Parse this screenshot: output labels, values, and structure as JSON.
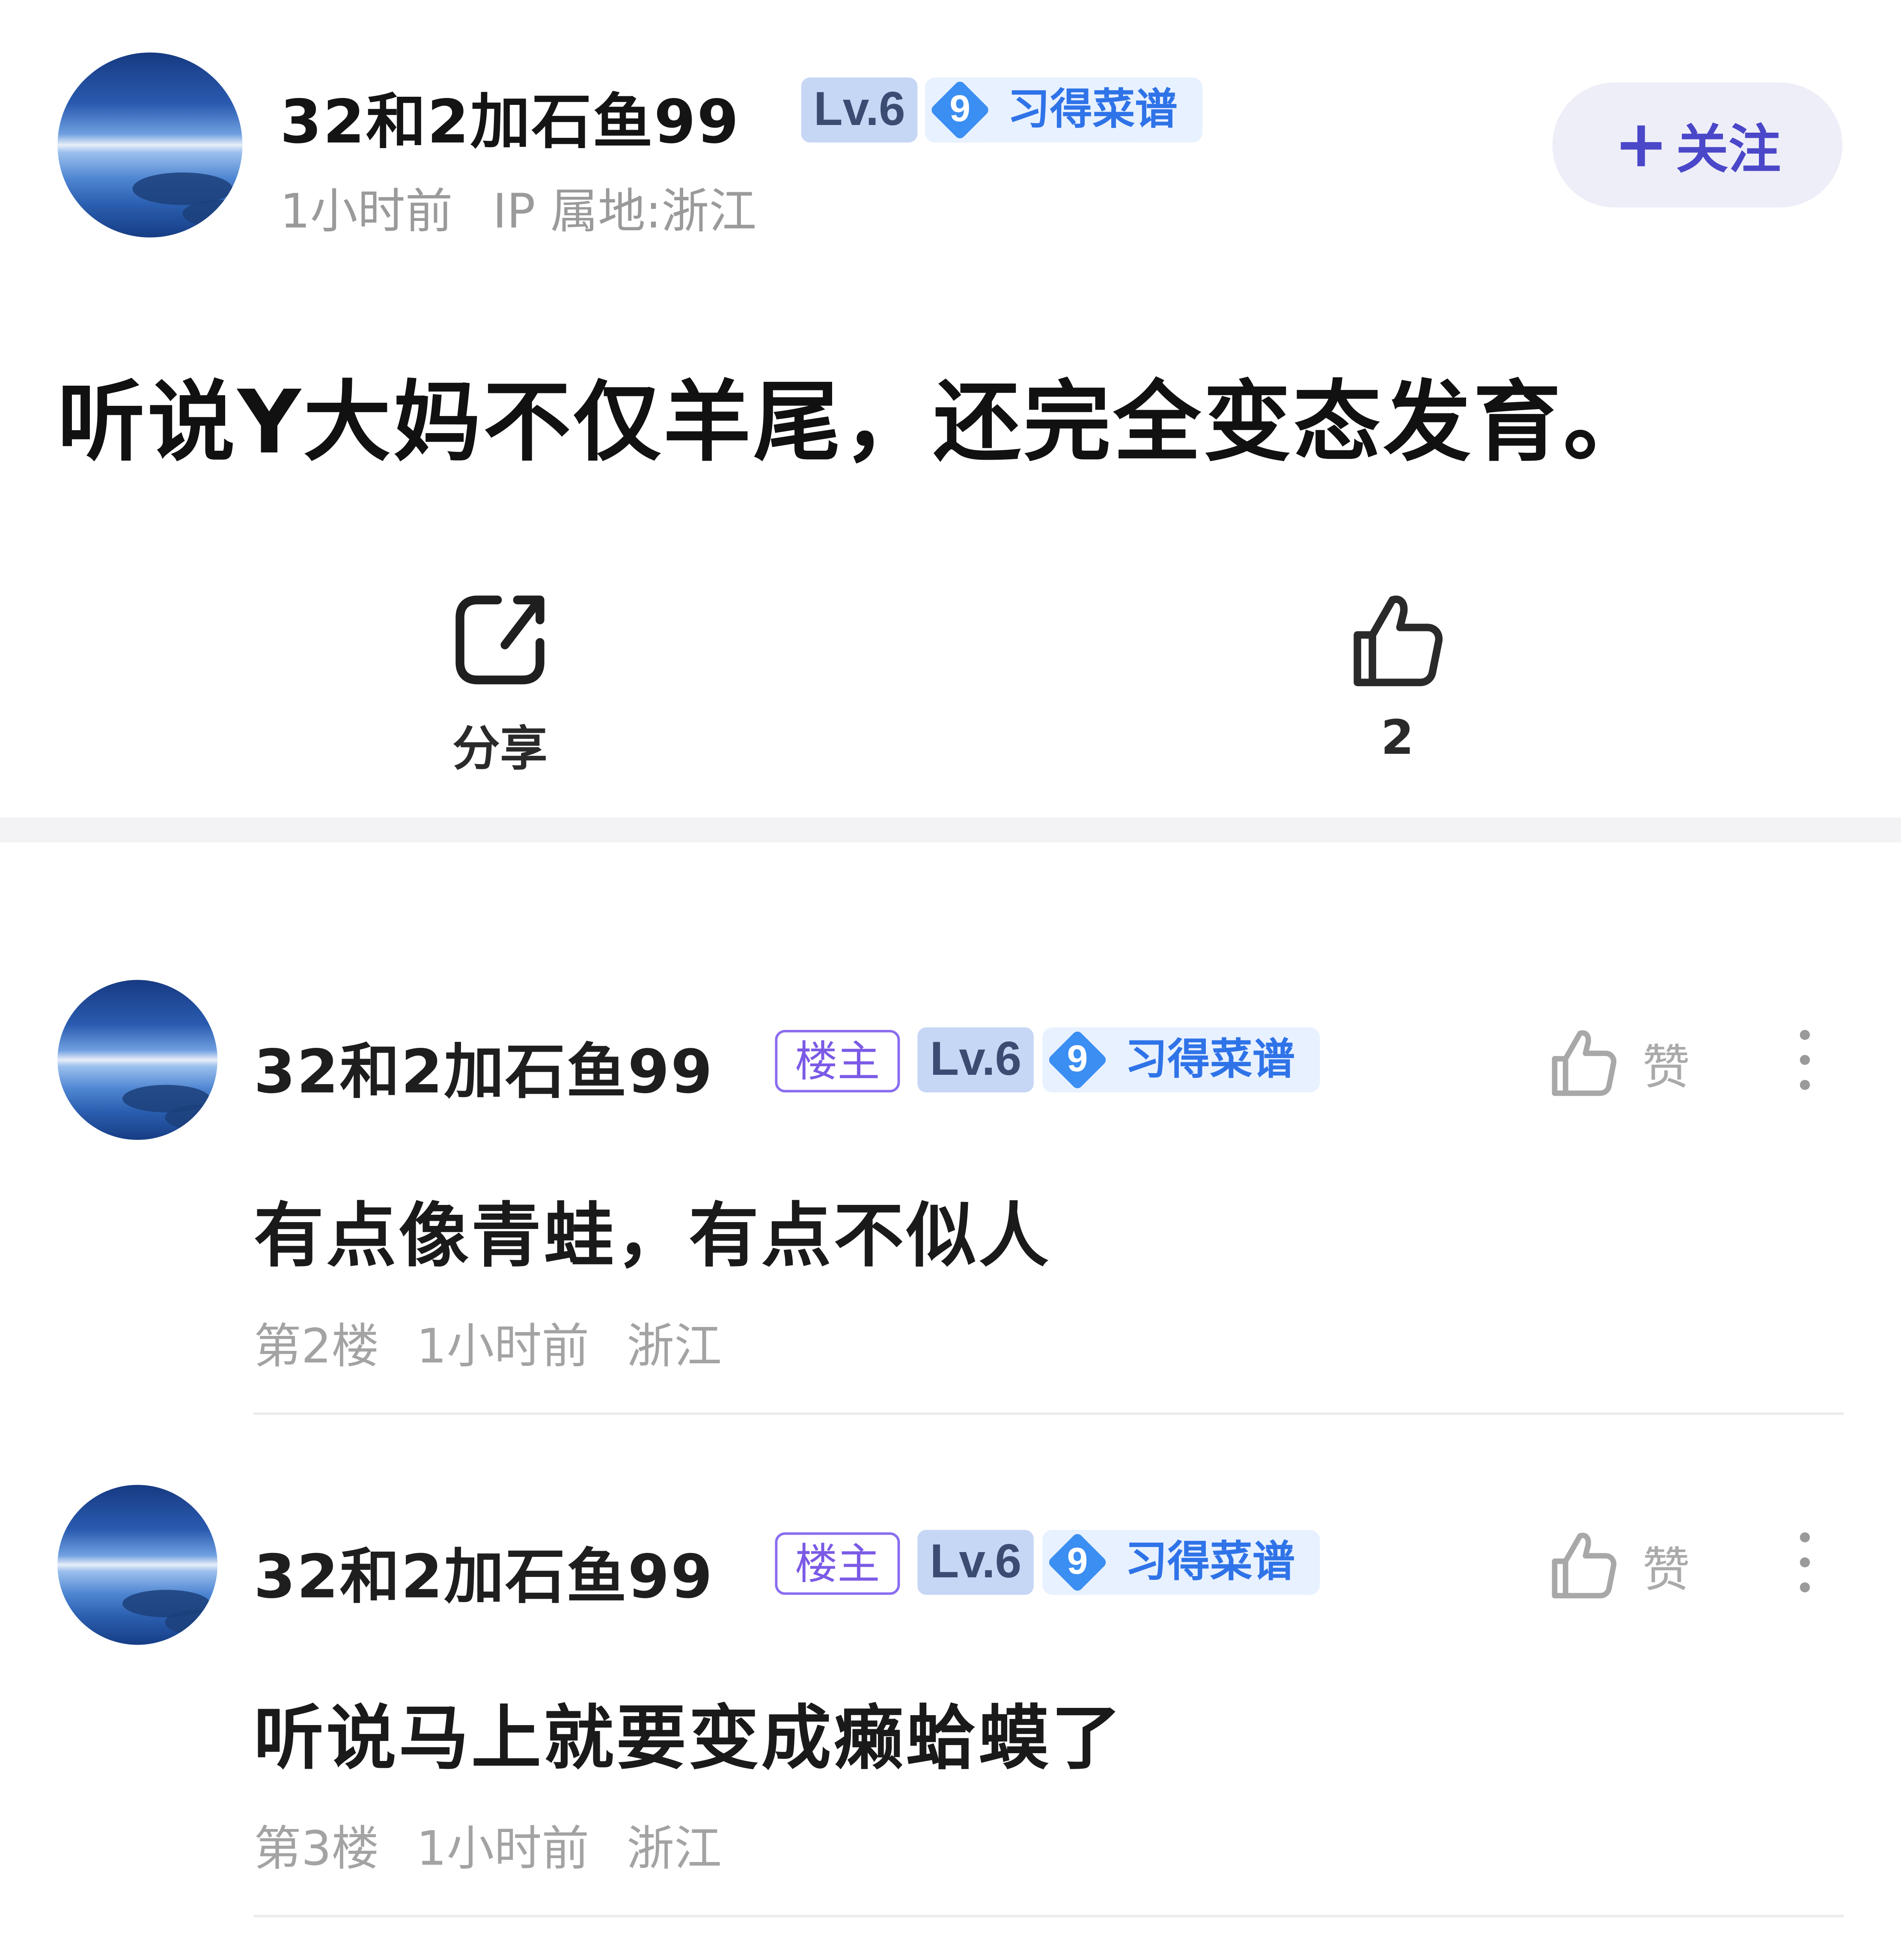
{
  "post": {
    "author": {
      "name": "32和2加石鱼99",
      "level": "Lv.6",
      "medal_number": "9",
      "medal_label": "习得菜谱"
    },
    "time": "1小时前",
    "ip_location": "IP 属地:浙江",
    "follow_label": "关注",
    "follow_icon": "+",
    "title": "听说Y大妈不仅羊尾，还完全变态发育。",
    "actions": {
      "share_label": "分享",
      "like_count": "2"
    }
  },
  "comments": [
    {
      "author": "32和2加石鱼99",
      "owner_badge": "楼主",
      "level": "Lv.6",
      "medal_number": "9",
      "medal_label": "习得菜谱",
      "like_label": "赞",
      "text": "有点像青蛙，有点不似人",
      "floor": "第2楼",
      "time": "1小时前",
      "location": "浙江"
    },
    {
      "author": "32和2加石鱼99",
      "owner_badge": "楼主",
      "level": "Lv.6",
      "medal_number": "9",
      "medal_label": "习得菜谱",
      "like_label": "赞",
      "text": "听说马上就要变成癞蛤蟆了",
      "floor": "第3楼",
      "time": "1小时前",
      "location": "浙江"
    }
  ],
  "colors": {
    "accent": "#4b47c9",
    "medal_blue": "#2f73e8",
    "owner_purple": "#7b5ae6",
    "meta_gray": "#9a9a9a"
  },
  "icons": {
    "share": "share-icon",
    "like": "thumbs-up-icon",
    "more": "more-vertical-icon"
  }
}
